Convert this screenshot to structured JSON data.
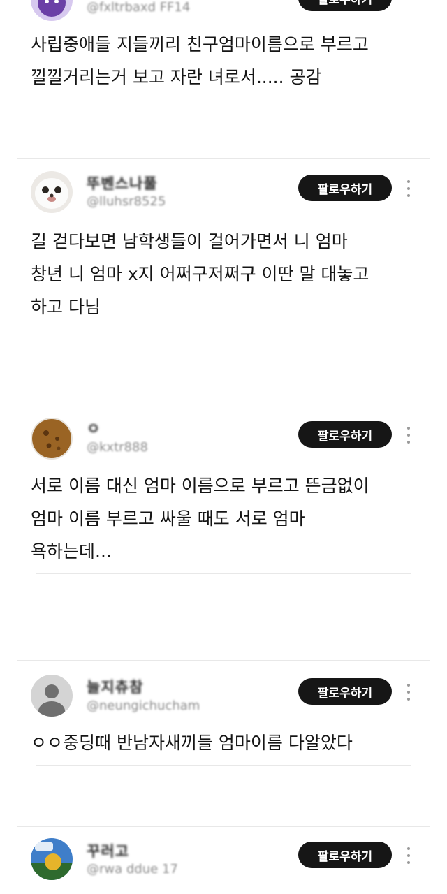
{
  "feed": {
    "follow_label": "팔로우하기",
    "posts": [
      {
        "avatar": "purple-character-avatar",
        "nickname": "",
        "handle": "@fxltrbaxd FF14",
        "lines": [
          "사립중애들 지들끼리 친구엄마이름으로 부르고",
          "낄낄거리는거 보고 자란 녀로서..... 공감"
        ]
      },
      {
        "avatar": "white-puppy-avatar",
        "nickname": "뚜벤스나풀",
        "handle": "@lluhsr8525",
        "lines": [
          "길 걷다보면 남학생들이 걸어가면서 니 엄마",
          "창년 니 엄마 x지 어쩌구저쩌구 이딴 말 대놓고",
          "하고 다님"
        ]
      },
      {
        "avatar": "cookie-avatar",
        "nickname": "ㅇ",
        "handle": "@kxtr888",
        "lines": [
          "서로 이름 대신 엄마 이름으로 부르고 뜬금없이",
          "엄마 이름 부르고 싸울 때도 서로 엄마",
          "욕하는데..."
        ]
      },
      {
        "avatar": "default-user-avatar",
        "nickname": "늘지츄참",
        "handle": "@neungichucham",
        "lines": [
          "ㅇㅇ중딩때 반남자새끼들 엄마이름 다알았다"
        ]
      },
      {
        "avatar": "cartoon-avatar",
        "nickname": "꾸러고",
        "handle": "@rwa ddue 17",
        "lines": []
      }
    ]
  },
  "colors": {
    "background": "#ffffff",
    "text": "#151515",
    "handle": "#8a8a8a",
    "follow_button": "#161616",
    "divider": "#e8e8e8"
  }
}
